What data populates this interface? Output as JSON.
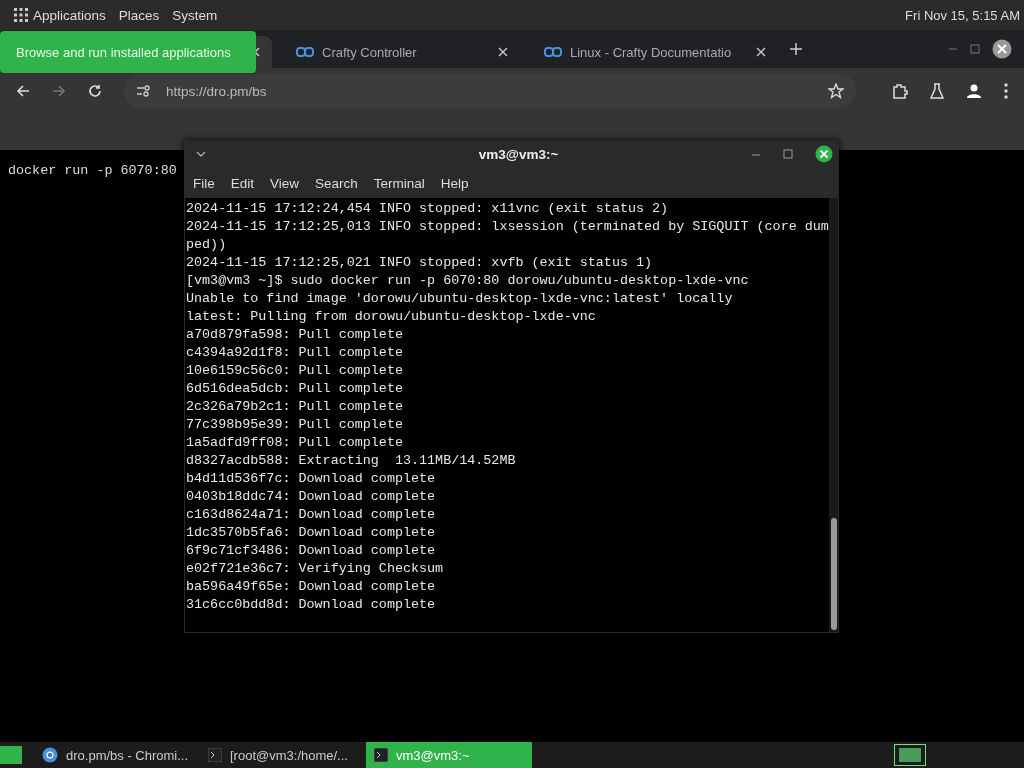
{
  "top_panel": {
    "menus": [
      "Applications",
      "Places",
      "System"
    ],
    "clock": "Fri Nov 15,  5:15 AM"
  },
  "tooltip": "Browse and run installed applications",
  "browser": {
    "tabs": [
      {
        "selected": true
      },
      {
        "title": "Crafty Controller",
        "selected": false
      },
      {
        "title": "Linux - Crafty Documentatio",
        "selected": false
      }
    ],
    "address": "https://dro.pm/bs",
    "page_text": "docker run -p 6070:80"
  },
  "terminal": {
    "title": "vm3@vm3:~",
    "menu": [
      "File",
      "Edit",
      "View",
      "Search",
      "Terminal",
      "Help"
    ],
    "lines": [
      "2024-11-15 17:12:24,454 INFO stopped: x11vnc (exit status 2)",
      "2024-11-15 17:12:25,013 INFO stopped: lxsession (terminated by SIGQUIT (core dum",
      "ped))",
      "2024-11-15 17:12:25,021 INFO stopped: xvfb (exit status 1)",
      "[vm3@vm3 ~]$ sudo docker run -p 6070:80 dorowu/ubuntu-desktop-lxde-vnc",
      "Unable to find image 'dorowu/ubuntu-desktop-lxde-vnc:latest' locally",
      "latest: Pulling from dorowu/ubuntu-desktop-lxde-vnc",
      "a70d879fa598: Pull complete",
      "c4394a92d1f8: Pull complete",
      "10e6159c56c0: Pull complete",
      "6d516dea5dcb: Pull complete",
      "2c326a79b2c1: Pull complete",
      "77c398b95e39: Pull complete",
      "1a5adfd9ff08: Pull complete",
      "d8327acdb588: Extracting  13.11MB/14.52MB",
      "b4d11d536f7c: Download complete",
      "0403b18ddc74: Download complete",
      "c163d8624a71: Download complete",
      "1dc3570b5fa6: Download complete",
      "6f9c71cf3486: Download complete",
      "e02f721e36c7: Verifying Checksum",
      "ba596a49f65e: Download complete",
      "31c6cc0bdd8d: Download complete"
    ]
  },
  "taskbar": {
    "items": [
      {
        "kind": "browser",
        "label": "dro.pm/bs - Chromi...",
        "selected": false
      },
      {
        "kind": "terminal",
        "label": "[root@vm3:/home/...",
        "selected": false
      },
      {
        "kind": "terminal",
        "label": "vm3@vm3:~",
        "selected": true
      }
    ]
  }
}
